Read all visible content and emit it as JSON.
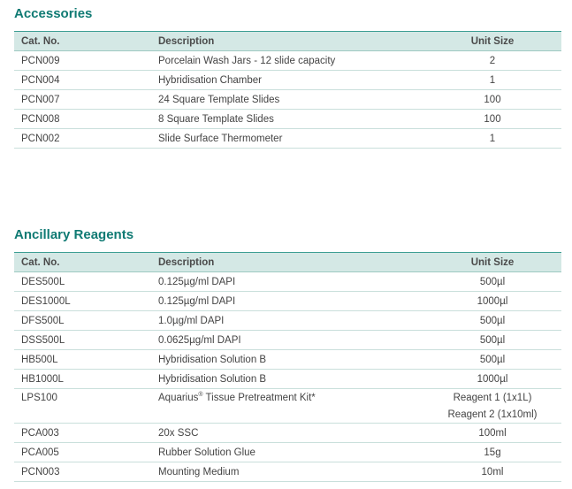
{
  "accessories": {
    "title": "Accessories",
    "headers": {
      "cat": "Cat. No.",
      "desc": "Description",
      "unit": "Unit Size"
    },
    "rows": [
      {
        "cat": "PCN009",
        "desc": "Porcelain Wash Jars - 12 slide capacity",
        "unit": "2"
      },
      {
        "cat": "PCN004",
        "desc": "Hybridisation Chamber",
        "unit": "1"
      },
      {
        "cat": "PCN007",
        "desc": "24 Square Template Slides",
        "unit": "100"
      },
      {
        "cat": "PCN008",
        "desc": "8 Square Template Slides",
        "unit": "100"
      },
      {
        "cat": "PCN002",
        "desc": "Slide Surface Thermometer",
        "unit": "1"
      }
    ]
  },
  "reagents": {
    "title": "Ancillary Reagents",
    "headers": {
      "cat": "Cat. No.",
      "desc": "Description",
      "unit": "Unit Size"
    },
    "rows": [
      {
        "cat": "DES500L",
        "desc": "0.125µg/ml DAPI",
        "unit": "500µl"
      },
      {
        "cat": "DES1000L",
        "desc": "0.125µg/ml DAPI",
        "unit": "1000µl"
      },
      {
        "cat": "DFS500L",
        "desc": "1.0µg/ml DAPI",
        "unit": "500µl"
      },
      {
        "cat": "DSS500L",
        "desc": "0.0625µg/ml DAPI",
        "unit": "500µl"
      },
      {
        "cat": "HB500L",
        "desc": "Hybridisation Solution B",
        "unit": "500µl"
      },
      {
        "cat": "HB1000L",
        "desc": "Hybridisation Solution B",
        "unit": "1000µl"
      },
      {
        "cat": "LPS100",
        "desc_main": "Aquarius",
        "desc_sup": "®",
        "desc_rest": " Tissue Pretreatment Kit*",
        "unit": "Reagent 1 (1x1L)",
        "unit_2": "Reagent 2 (1x10ml)"
      },
      {
        "cat": "PCA003",
        "desc": "20x SSC",
        "unit": "100ml"
      },
      {
        "cat": "PCA005",
        "desc": "Rubber Solution Glue",
        "unit": "15g"
      },
      {
        "cat": "PCN003",
        "desc": "Mounting Medium",
        "unit": "10ml"
      }
    ]
  }
}
